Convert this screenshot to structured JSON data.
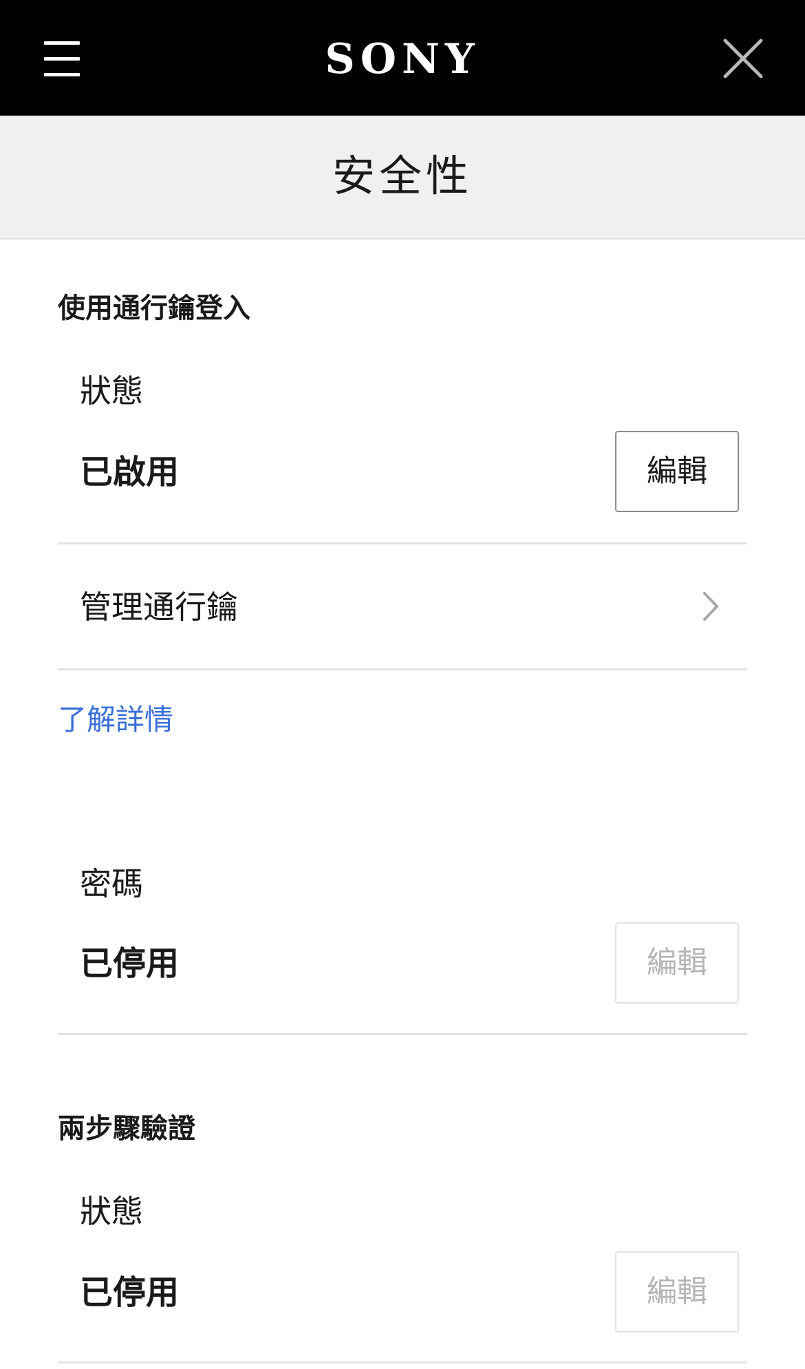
{
  "header": {
    "brand": "SONY"
  },
  "page": {
    "title": "安全性"
  },
  "passkey_section": {
    "heading": "使用通行鑰登入",
    "status_label": "狀態",
    "status_value": "已啟用",
    "edit_label": "編輯",
    "manage_label": "管理通行鑰",
    "learn_more": "了解詳情"
  },
  "password_section": {
    "label": "密碼",
    "value": "已停用",
    "edit_label": "編輯"
  },
  "two_step_section": {
    "heading": "兩步驟驗證",
    "status_label": "狀態",
    "status_value": "已停用",
    "edit_label": "編輯"
  },
  "icons": {
    "menu": "hamburger-menu-icon",
    "close": "close-icon",
    "chevron": "chevron-right-icon"
  },
  "colors": {
    "header_bg": "#000000",
    "subheader_bg": "#f0f0f0",
    "link": "#3a6fd8",
    "disabled_text": "#b5b5b5"
  }
}
